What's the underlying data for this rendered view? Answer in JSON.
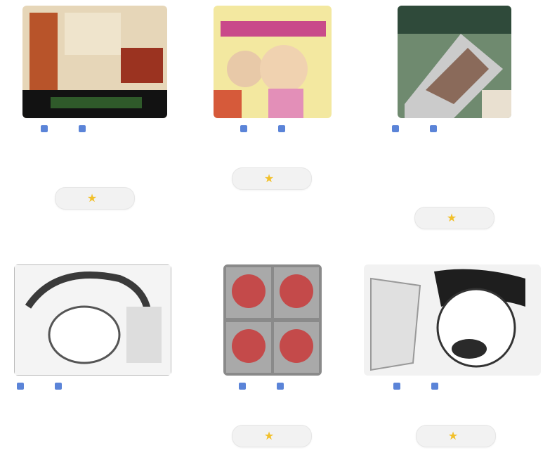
{
  "cards": [
    {
      "meta_left": "",
      "meta_right": "",
      "caption_1": "",
      "caption_2": "",
      "caption_3": "",
      "button_label": ""
    },
    {
      "meta_left": "",
      "meta_right": "",
      "caption_1": "",
      "caption_2": "",
      "caption_3": "",
      "button_label": ""
    },
    {
      "meta_left": "",
      "meta_right": "",
      "caption_1": "",
      "caption_2": "",
      "caption_3": "",
      "button_label": ""
    },
    {
      "meta_left": "",
      "meta_right": "",
      "caption_1": "",
      "caption_2": "",
      "caption_3": "",
      "button_label": ""
    },
    {
      "meta_left": "",
      "meta_right": "",
      "caption_1": "",
      "caption_2": "",
      "caption_3": "",
      "button_label": ""
    },
    {
      "meta_left": "",
      "meta_right": "",
      "caption_1": "",
      "caption_2": "",
      "caption_3": "",
      "button_label": ""
    }
  ],
  "icons": {
    "meta": "tag-icon",
    "button": "star-icon"
  },
  "colors": {
    "accent": "#5b84d8",
    "star": "#f2c02a",
    "button_bg": "#f2f2f2"
  }
}
